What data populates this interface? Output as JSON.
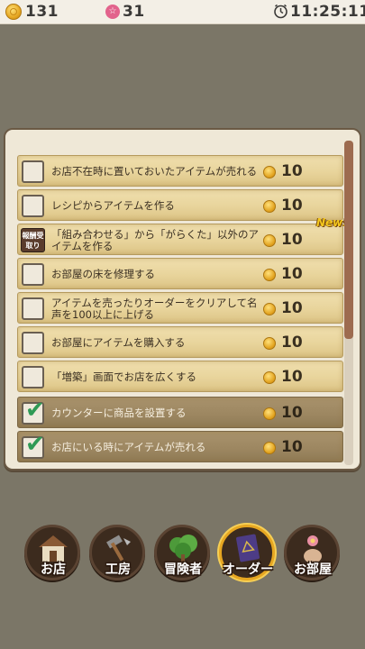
{
  "status_bar": {
    "coins": "131",
    "gems": "31",
    "gem_icon": "☆",
    "time": "11:25:11"
  },
  "orders": [
    {
      "text": "お店不在時に置いておいたアイテムが売れる",
      "reward": "10",
      "state": "unchecked"
    },
    {
      "text": "レシピからアイテムを作る",
      "reward": "10",
      "state": "unchecked"
    },
    {
      "text": "「組み合わせる」から「がらくた」以外のアイテムを作る",
      "reward": "10",
      "state": "reward",
      "reward_icon_text": "報酬受取り",
      "badge": "New!"
    },
    {
      "text": "お部屋の床を修理する",
      "reward": "10",
      "state": "unchecked"
    },
    {
      "text": "アイテムを売ったりオーダーをクリアして名声を100以上に上げる",
      "reward": "10",
      "state": "unchecked"
    },
    {
      "text": "お部屋にアイテムを購入する",
      "reward": "10",
      "state": "unchecked"
    },
    {
      "text": "「増築」画面でお店を広くする",
      "reward": "10",
      "state": "unchecked"
    },
    {
      "text": "カウンターに商品を設置する",
      "reward": "10",
      "state": "done"
    },
    {
      "text": "お店にいる時にアイテムが売れる",
      "reward": "10",
      "state": "done"
    }
  ],
  "nav": [
    {
      "label": "お店",
      "icon": "shop-house-icon",
      "active": false
    },
    {
      "label": "工房",
      "icon": "workshop-tools-icon",
      "active": false
    },
    {
      "label": "冒険者",
      "icon": "adventurer-tree-icon",
      "active": false
    },
    {
      "label": "オーダー",
      "icon": "order-book-icon",
      "active": true
    },
    {
      "label": "お部屋",
      "icon": "room-flower-vase-icon",
      "active": false
    }
  ],
  "colors": {
    "background": "#7b7667",
    "row_active": "#e8d49b",
    "row_done": "#9c8660",
    "check_green": "#2f9a55",
    "scrollbar": "#9d6b4f",
    "active_ring": "#e6a621"
  }
}
